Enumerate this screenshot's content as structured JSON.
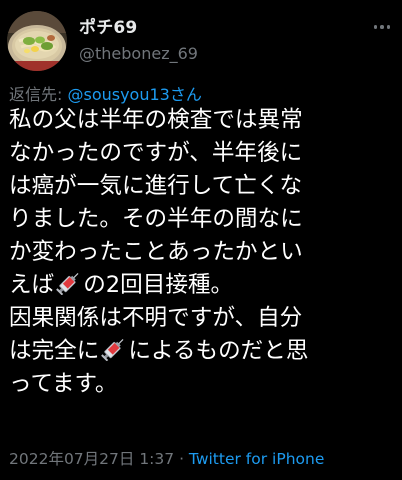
{
  "user": {
    "display_name": "ポチ69",
    "handle": "@thebonez_69",
    "avatar": "ramen-bowl-avatar"
  },
  "more_icon": "more-dots-icon",
  "reply": {
    "prefix": "返信先: ",
    "mention": "@sousyou13さん"
  },
  "tweet": {
    "lines": [
      {
        "segments": [
          {
            "text": "私の父は半年の検査では異常"
          }
        ]
      },
      {
        "segments": [
          {
            "text": "なかったのですが、半年後に"
          }
        ]
      },
      {
        "segments": [
          {
            "text": "は癌が一気に進行して亡くな"
          }
        ]
      },
      {
        "segments": [
          {
            "text": "りました。その半年の間なに"
          }
        ]
      },
      {
        "segments": [
          {
            "text": "か変わったことあったかとい"
          }
        ]
      },
      {
        "segments": [
          {
            "text": "えば"
          },
          {
            "emoji": "syringe-emoji"
          },
          {
            "text": "の2回目接種。"
          }
        ]
      },
      {
        "segments": [
          {
            "text": "因果関係は不明ですが、自分"
          }
        ]
      },
      {
        "segments": [
          {
            "text": "は完全に"
          },
          {
            "emoji": "syringe-emoji"
          },
          {
            "text": "によるものだと思"
          }
        ]
      },
      {
        "segments": [
          {
            "text": "ってます。"
          }
        ]
      }
    ]
  },
  "meta": {
    "timestamp": "2022年07月27日 1:37",
    "separator": " · ",
    "source": "Twitter for iPhone"
  },
  "colors": {
    "background": "#000000",
    "text": "#ffffff",
    "secondary": "#71767b",
    "link": "#1d9bf0"
  }
}
